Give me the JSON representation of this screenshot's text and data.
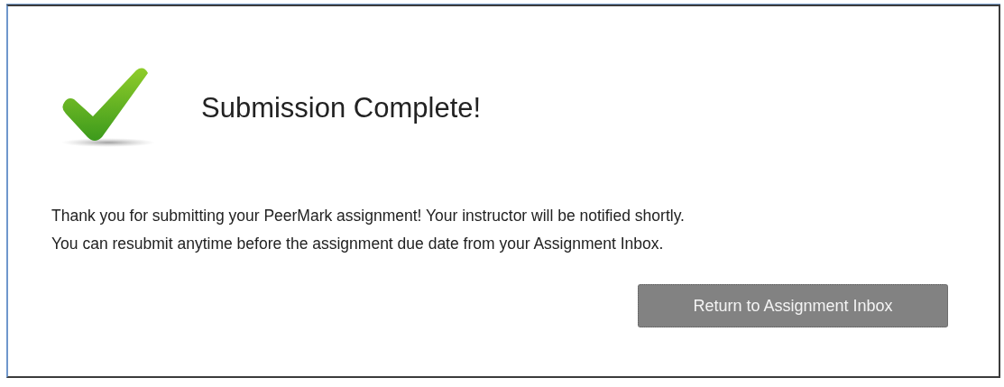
{
  "dialog": {
    "title": "Submission Complete!",
    "message_lines": [
      "Thank you for submitting your PeerMark assignment! Your instructor will be notified shortly.",
      "You can resubmit anytime before the assignment due date from your Assignment Inbox."
    ],
    "button": "Return to Assignment Inbox"
  }
}
